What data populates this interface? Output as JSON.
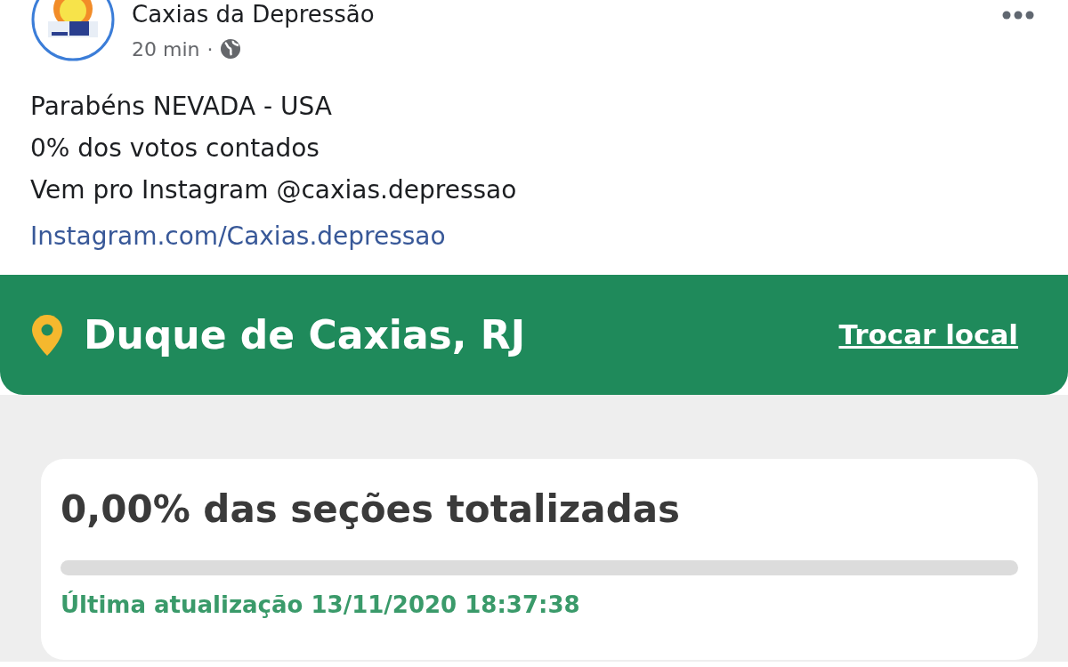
{
  "post": {
    "author": "Caxias da Depressão",
    "time": "20 min",
    "separator": "·",
    "lines": [
      "Parabéns NEVADA - USA",
      "0% dos votos contados",
      "Vem pro Instagram @caxias.depressao"
    ],
    "link": "Instagram.com/Caxias.depressao"
  },
  "banner": {
    "location": "Duque de Caxias, RJ",
    "action": "Trocar local"
  },
  "card": {
    "title": "0,00% das seções totalizadas",
    "progress": {
      "level": 0
    },
    "updated": "Última atualização 13/11/2020 18:37:38"
  }
}
